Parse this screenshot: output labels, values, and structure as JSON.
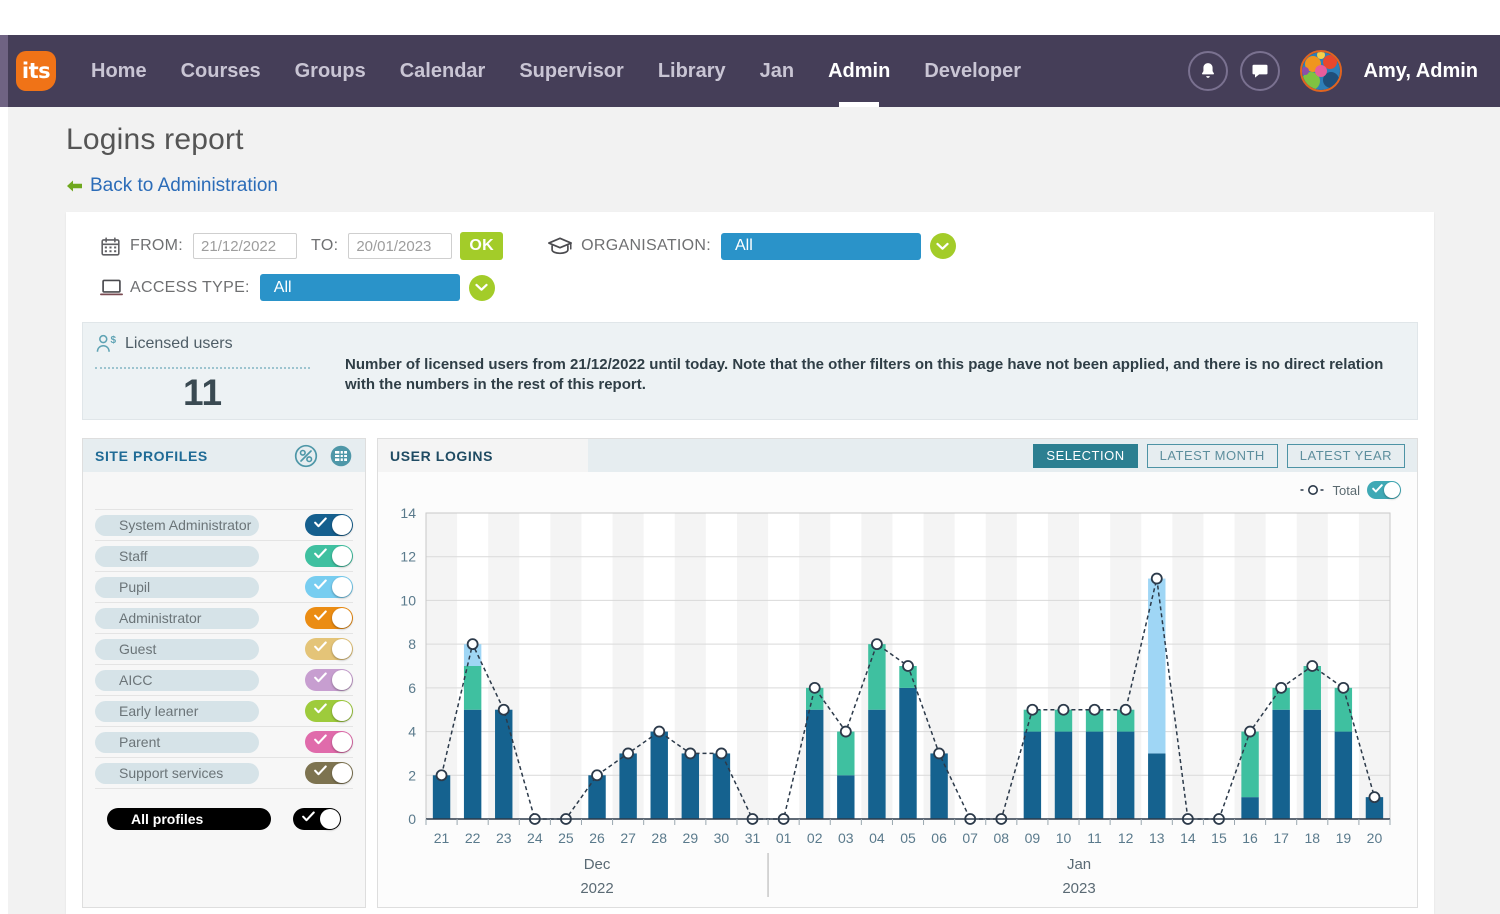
{
  "nav": {
    "logo_text": "its",
    "items": [
      {
        "label": "Home",
        "active": false
      },
      {
        "label": "Courses",
        "active": false
      },
      {
        "label": "Groups",
        "active": false
      },
      {
        "label": "Calendar",
        "active": false
      },
      {
        "label": "Supervisor",
        "active": false
      },
      {
        "label": "Library",
        "active": false
      },
      {
        "label": "Jan",
        "active": false
      },
      {
        "label": "Admin",
        "active": true
      },
      {
        "label": "Developer",
        "active": false
      }
    ],
    "user_name": "Amy, Admin",
    "bell_icon": "bell-icon",
    "chat_icon": "chat-icon",
    "avatar_icon": "avatar"
  },
  "page": {
    "title": "Logins report",
    "back_link": "Back to Administration"
  },
  "filters": {
    "calendar_icon": "calendar-icon",
    "from_label": "FROM:",
    "from_value": "21/12/2022",
    "to_label": "TO:",
    "to_value": "20/01/2023",
    "ok_label": "OK",
    "organisation_icon": "graduation-cap-icon",
    "organisation_label": "ORGANISATION:",
    "organisation_value": "All",
    "access_icon": "laptop-icon",
    "access_label": "ACCESS TYPE:",
    "access_value": "All"
  },
  "licensed": {
    "icon": "user-dollar-icon",
    "title": "Licensed users",
    "count": "11",
    "description": "Number of licensed users from 21/12/2022 until today. Note that the other filters on this page have not been applied, and there is no direct relation with the numbers in the rest of this report."
  },
  "site_profiles": {
    "header": "SITE PROFILES",
    "percent_icon": "percent-circle-icon",
    "table_icon": "table-circle-icon",
    "items": [
      {
        "label": "System Administrator",
        "color": "#155f8e",
        "on": true
      },
      {
        "label": "Staff",
        "color": "#3fc0a0",
        "on": true
      },
      {
        "label": "Pupil",
        "color": "#77cdf0",
        "on": true
      },
      {
        "label": "Administrator",
        "color": "#eb8c13",
        "on": true
      },
      {
        "label": "Guest",
        "color": "#e4c478",
        "on": true
      },
      {
        "label": "AICC",
        "color": "#c79ed0",
        "on": true
      },
      {
        "label": "Early learner",
        "color": "#9ecb3c",
        "on": true
      },
      {
        "label": "Parent",
        "color": "#e06bab",
        "on": true
      },
      {
        "label": "Support services",
        "color": "#7d7350",
        "on": true
      }
    ],
    "all_label": "All profiles",
    "all_color": "#000000",
    "all_on": true
  },
  "user_logins": {
    "header": "USER LOGINS",
    "tabs": [
      {
        "label": "SELECTION",
        "active": true
      },
      {
        "label": "LATEST MONTH",
        "active": false
      },
      {
        "label": "LATEST YEAR",
        "active": false
      }
    ],
    "legend_label": "Total",
    "legend_on": true
  },
  "chart_data": {
    "type": "bar",
    "stacked": true,
    "title": "USER LOGINS",
    "xlabel": "",
    "ylabel": "",
    "ylim": [
      0,
      14
    ],
    "yticks": [
      0,
      2,
      4,
      6,
      8,
      10,
      12,
      14
    ],
    "grid": true,
    "legend": [
      "Total"
    ],
    "legend_position": "top-right",
    "categories": [
      "21",
      "22",
      "23",
      "24",
      "25",
      "26",
      "27",
      "28",
      "29",
      "30",
      "31",
      "01",
      "02",
      "03",
      "04",
      "05",
      "06",
      "07",
      "08",
      "09",
      "10",
      "11",
      "12",
      "13",
      "14",
      "15",
      "16",
      "17",
      "18",
      "19",
      "20"
    ],
    "group_labels": [
      {
        "label": "Dec",
        "sublabel": "2022",
        "from": "21",
        "to": "31"
      },
      {
        "label": "Jan",
        "sublabel": "2023",
        "from": "01",
        "to": "20"
      }
    ],
    "series": [
      {
        "name": "System Administrator",
        "color": "#15628f",
        "values": [
          2,
          5,
          5,
          0,
          0,
          2,
          3,
          4,
          3,
          3,
          0,
          0,
          5,
          2,
          5,
          6,
          3,
          0,
          0,
          4,
          4,
          4,
          4,
          3,
          0,
          0,
          1,
          5,
          5,
          4,
          1
        ]
      },
      {
        "name": "Staff",
        "color": "#3fc0a0",
        "values": [
          0,
          2,
          0,
          0,
          0,
          0,
          0,
          0,
          0,
          0,
          0,
          0,
          1,
          2,
          3,
          1,
          0,
          0,
          0,
          1,
          1,
          1,
          1,
          0,
          0,
          0,
          3,
          1,
          2,
          2,
          0
        ]
      },
      {
        "name": "Pupil",
        "color": "#9fd6f5",
        "values": [
          0,
          1,
          0,
          0,
          0,
          0,
          0,
          0,
          0,
          0,
          0,
          0,
          0,
          0,
          0,
          0,
          0,
          0,
          0,
          0,
          0,
          0,
          0,
          8,
          0,
          0,
          0,
          0,
          0,
          0,
          0
        ]
      }
    ],
    "total": [
      2,
      8,
      5,
      0,
      0,
      2,
      3,
      4,
      3,
      3,
      0,
      0,
      6,
      4,
      8,
      7,
      3,
      0,
      0,
      5,
      5,
      5,
      5,
      11,
      0,
      0,
      4,
      6,
      7,
      6,
      1
    ]
  }
}
